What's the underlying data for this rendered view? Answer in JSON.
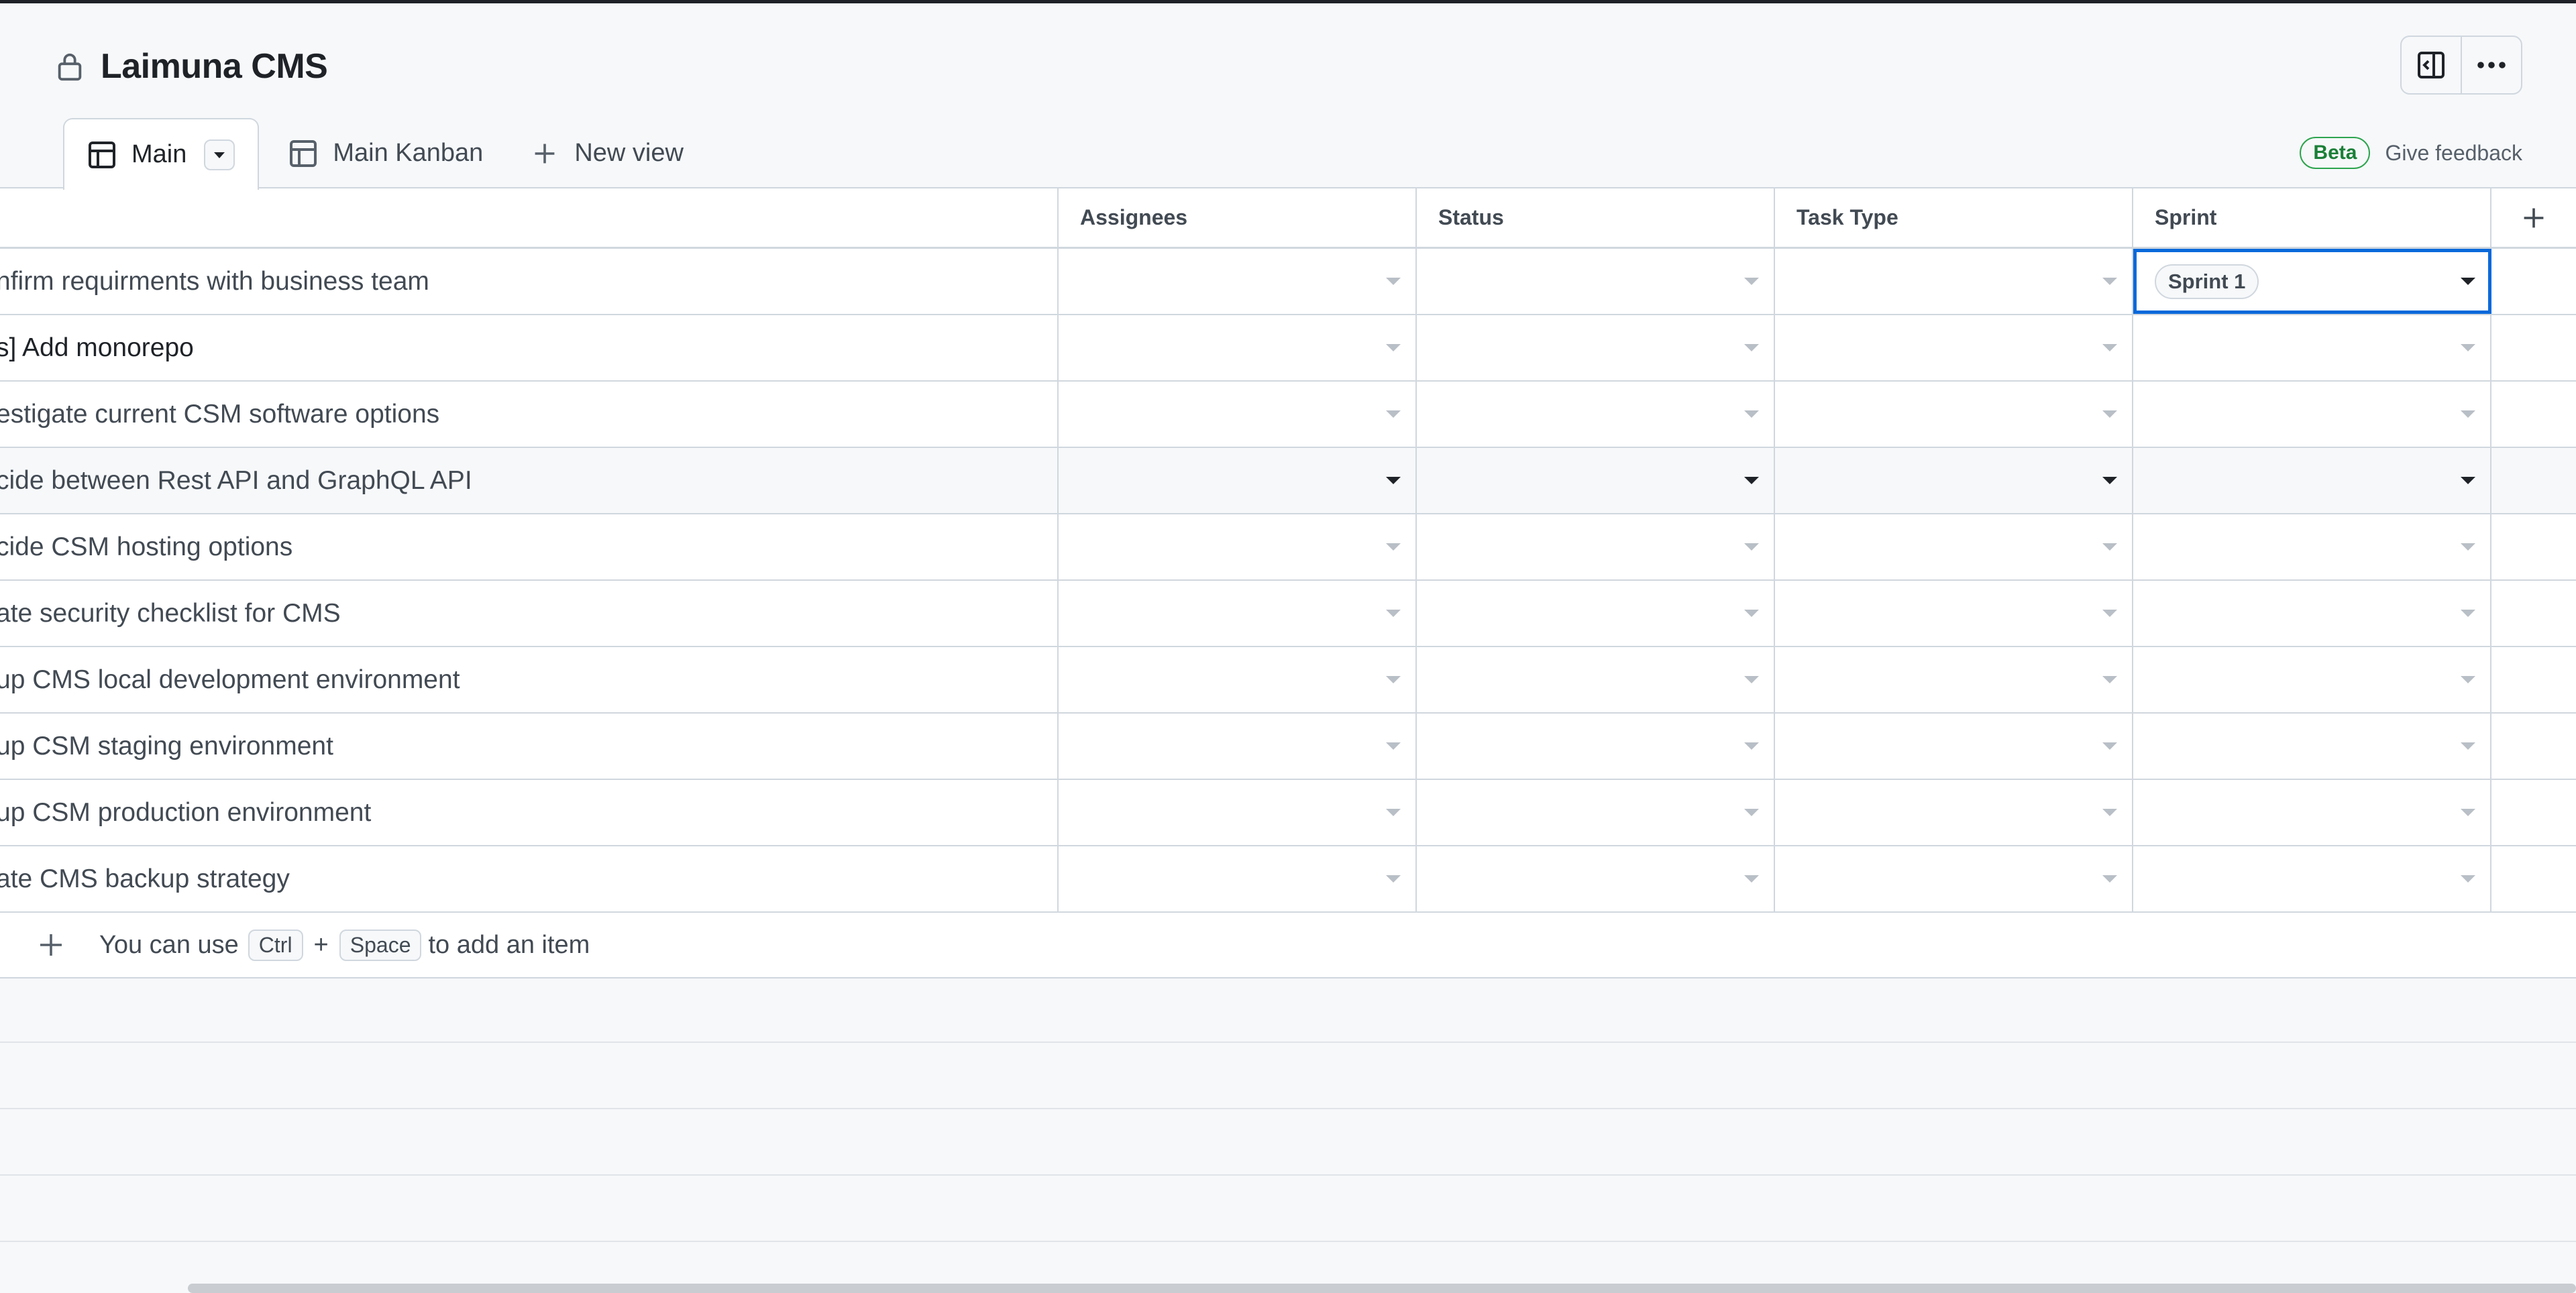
{
  "project": {
    "title": "Laimuna CMS"
  },
  "icons": {
    "lock": "lock-icon",
    "sidebar_toggle": "sidebar-toggle-icon",
    "more": "kebab-horizontal-icon",
    "table": "table-icon",
    "plus": "plus-icon",
    "caret": "triangle-down-icon"
  },
  "tabs": [
    {
      "label": "Main",
      "active": true
    },
    {
      "label": "Main Kanban",
      "active": false
    }
  ],
  "new_view": {
    "label": "New view"
  },
  "feedback": {
    "badge": "Beta",
    "link": "Give feedback"
  },
  "columns": [
    "Assignees",
    "Status",
    "Task Type",
    "Sprint"
  ],
  "rows": [
    {
      "title": "nfirm requirments with business team",
      "sprint": "Sprint 1"
    },
    {
      "title": "s] Add monorepo",
      "sprint": ""
    },
    {
      "title": "estigate current CSM software options",
      "sprint": ""
    },
    {
      "title": "cide between Rest API and GraphQL API",
      "sprint": ""
    },
    {
      "title": "cide CSM hosting options",
      "sprint": ""
    },
    {
      "title": "ate security checklist for CMS",
      "sprint": ""
    },
    {
      "title": "up CMS local development environment",
      "sprint": ""
    },
    {
      "title": "up CSM staging environment",
      "sprint": ""
    },
    {
      "title": "up CSM production environment",
      "sprint": ""
    },
    {
      "title": "ate CMS backup strategy",
      "sprint": ""
    }
  ],
  "add_item": {
    "prefix": "You can use",
    "key1": "Ctrl",
    "plus": "+",
    "key2": "Space",
    "suffix": "to add an item"
  },
  "colors": {
    "accent": "#0969da",
    "beta": "#1a7f37",
    "border": "#d0d7de"
  }
}
